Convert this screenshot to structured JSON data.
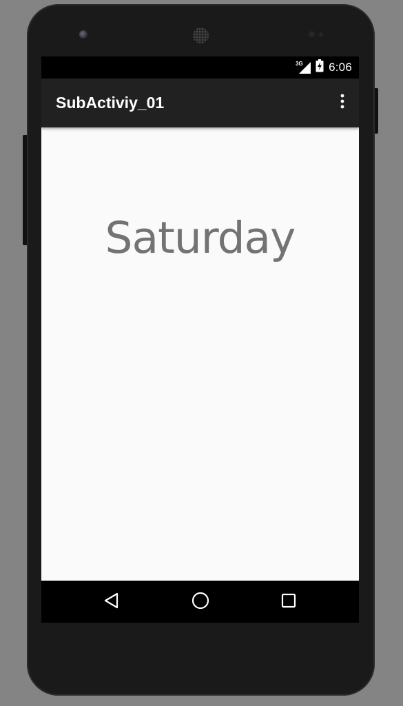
{
  "status_bar": {
    "network_type": "3G",
    "time": "6:06",
    "signal_icon": "cell-signal-icon",
    "battery_icon": "battery-charging-icon"
  },
  "app_bar": {
    "title": "SubActiviy_01",
    "overflow_icon": "more-vert-icon"
  },
  "main": {
    "day_text": "Saturday"
  },
  "nav_bar": {
    "back_icon": "back-triangle-icon",
    "home_icon": "home-circle-icon",
    "recents_icon": "recents-square-icon"
  },
  "colors": {
    "app_bar_bg": "#212121",
    "content_bg": "#fafafa",
    "day_text": "#737373",
    "status_bar_bg": "#000000",
    "nav_bar_bg": "#000000"
  }
}
